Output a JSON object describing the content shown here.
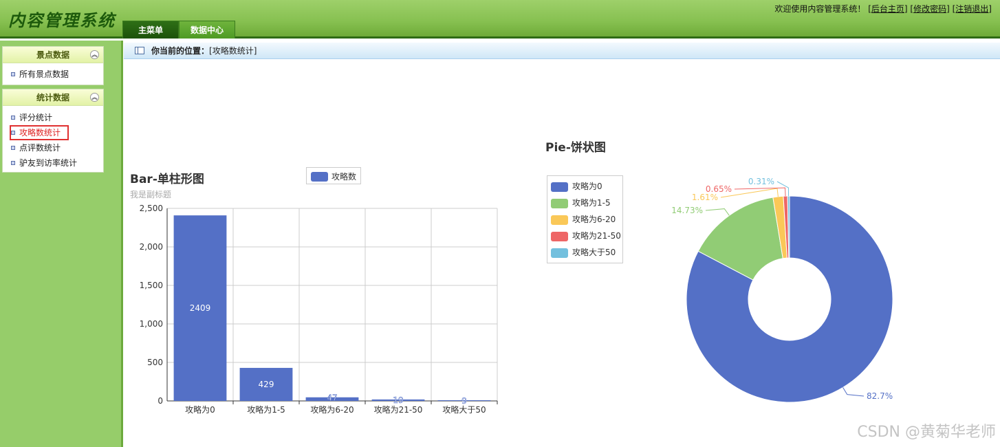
{
  "app": {
    "title": "内容管理系统"
  },
  "top_links": {
    "welcome": "欢迎使用内容管理系统！",
    "home": "[后台主页]",
    "change_password": "[修改密码]",
    "logout": "[注销退出]"
  },
  "tabs": [
    {
      "label": "主菜单"
    },
    {
      "label": "数据中心"
    }
  ],
  "sidebar": {
    "panels": [
      {
        "title": "景点数据",
        "items": [
          {
            "label": "所有景点数据"
          }
        ]
      },
      {
        "title": "统计数据",
        "items": [
          {
            "label": "评分统计"
          },
          {
            "label": "攻略数统计"
          },
          {
            "label": "点评数统计"
          },
          {
            "label": "驴友到访率统计"
          }
        ]
      }
    ]
  },
  "breadcrumb": {
    "prefix": "你当前的位置：",
    "current": "[攻略数统计]"
  },
  "watermark": "CSDN @黄菊华老师",
  "colors": {
    "blue": "#5470c6",
    "green": "#91cc75",
    "yellow": "#fac858",
    "red": "#ee6666",
    "cyan": "#73c0de"
  },
  "chart_data": [
    {
      "type": "bar",
      "title": "Bar-单柱形图",
      "subtitle": "我是副标题",
      "categories": [
        "攻略为0",
        "攻略为1-5",
        "攻略为6-20",
        "攻略为21-50",
        "攻略大于50"
      ],
      "series": [
        {
          "name": "攻略数",
          "values": [
            2409,
            429,
            47,
            19,
            9
          ]
        }
      ],
      "ylim": [
        0,
        2500
      ],
      "yticks": [
        "0",
        "500",
        "1,000",
        "1,500",
        "2,000",
        "2,500"
      ],
      "grid": true,
      "legend": "top-center"
    },
    {
      "type": "pie",
      "title": "Pie-饼状图",
      "slices": [
        {
          "name": "攻略为0",
          "value": 2409,
          "label": "82.7%"
        },
        {
          "name": "攻略为1-5",
          "value": 429,
          "label": "14.73%"
        },
        {
          "name": "攻略为6-20",
          "value": 47,
          "label": "1.61%"
        },
        {
          "name": "攻略为21-50",
          "value": 19,
          "label": "0.65%"
        },
        {
          "name": "攻略大于50",
          "value": 9,
          "label": "0.31%"
        }
      ],
      "donut": true,
      "legend": "left"
    }
  ]
}
